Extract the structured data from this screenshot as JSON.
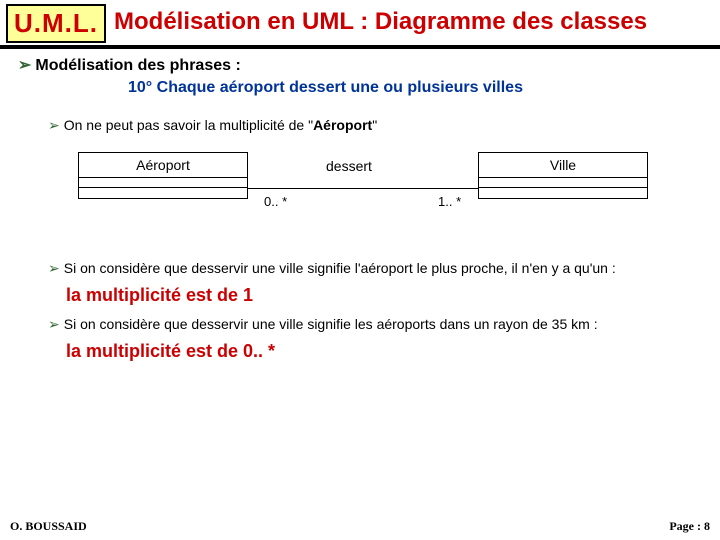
{
  "header": {
    "logo": "U.M.L.",
    "title": "Modélisation en UML : Diagramme des classes"
  },
  "content": {
    "heading": "Modélisation des phrases :",
    "phrase": "10° Chaque aéroport dessert  une ou plusieurs villes",
    "note_prefix": "On ne peut pas savoir la multiplicité de \"",
    "note_bold": "Aéroport",
    "note_suffix": "\"",
    "diagram": {
      "classA": "Aéroport",
      "classB": "Ville",
      "assoc": "dessert",
      "multL": "0.. *",
      "multR": "1.. *"
    },
    "case1": "Si on considère que desservir une ville signifie l'aéroport le plus proche, il n'en y a qu'un :",
    "concl1": "la multiplicité est de 1",
    "case2": "Si on considère que desservir une ville signifie les aéroports dans un rayon de 35 km :",
    "concl2": "la multiplicité est de 0.. *"
  },
  "footer": {
    "author": "O. BOUSSAID",
    "page": "Page : 8"
  }
}
